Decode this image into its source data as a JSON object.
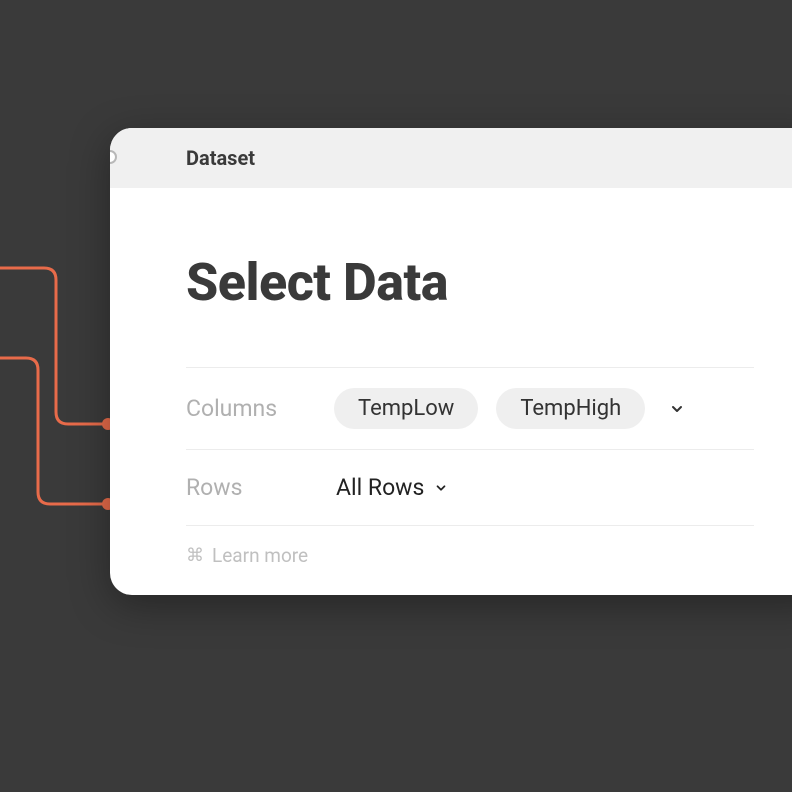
{
  "header": {
    "label": "Dataset"
  },
  "title": "Select Data",
  "fields": {
    "columns": {
      "label": "Columns",
      "chips": [
        "TempLow",
        "TempHigh"
      ]
    },
    "rows": {
      "label": "Rows",
      "value": "All Rows"
    }
  },
  "footer": {
    "learn_more": "Learn more"
  },
  "colors": {
    "wire": "#e86b4a",
    "bg": "#3a3a3a"
  }
}
